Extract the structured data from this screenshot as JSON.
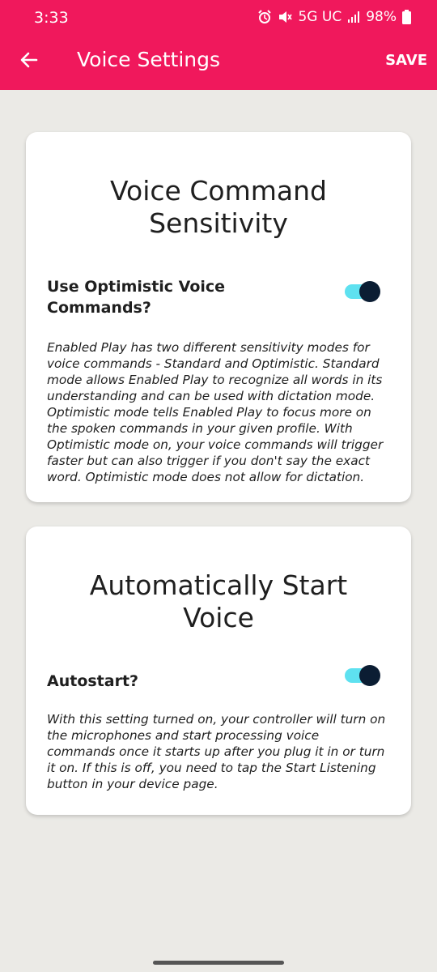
{
  "status_bar": {
    "time": "3:33",
    "network": "5G UC",
    "battery": "98%",
    "icons": [
      "alarm-icon",
      "mute-icon",
      "signal-icon",
      "battery-icon"
    ]
  },
  "app_bar": {
    "title": "Voice Settings",
    "save_label": "SAVE",
    "back_icon": "arrow-left-icon"
  },
  "colors": {
    "primary": "#f0185c",
    "background": "#ebeae6",
    "toggle_track": "#5ee1f0",
    "toggle_knob": "#0b1d33"
  },
  "cards": [
    {
      "title": "Voice Command Sensitivity",
      "setting_label": "Use Optimistic Voice Commands?",
      "toggle_on": true,
      "description": "Enabled Play has two different sensitivity modes for voice commands - Standard and Optimistic. Standard mode allows Enabled Play to recognize all words in its understanding and can be used with dictation mode. Optimistic mode tells Enabled Play to focus more on the spoken commands in your given profile. With Optimistic mode on, your voice commands will trigger faster but can also trigger if you don't say the exact word. Optimistic mode does not allow for dictation."
    },
    {
      "title": "Automatically Start Voice",
      "setting_label": "Autostart?",
      "toggle_on": true,
      "description": "With this setting turned on, your controller will turn on the microphones and start processing voice commands once it starts up after you plug it in or turn it on. If this is off, you need to tap the Start Listening button in your device page."
    }
  ]
}
